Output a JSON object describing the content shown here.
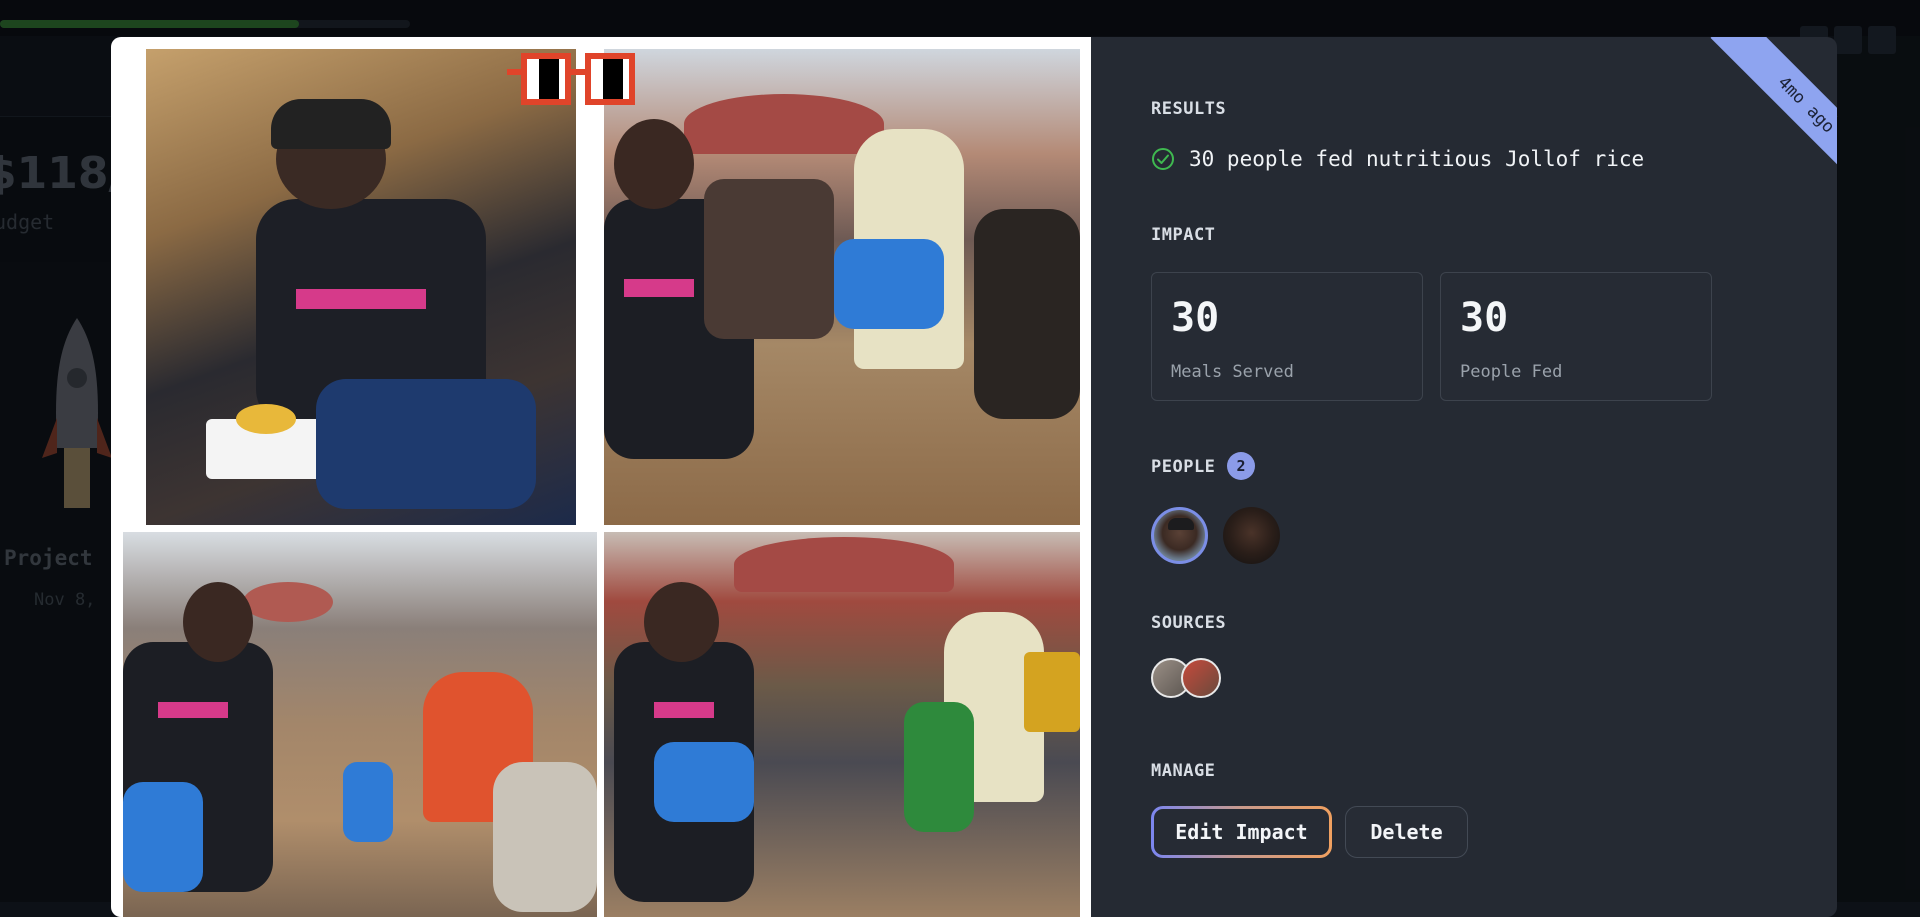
{
  "background_page": {
    "budget_amount": "$118/",
    "budget_label": "udget",
    "project_title": "Project ",
    "project_date": "Nov 8,",
    "progress_fraction": 0.73
  },
  "modal": {
    "ribbon_text": "4mo ago",
    "results": {
      "label": "RESULTS",
      "items": [
        "30 people fed nutritious Jollof rice"
      ]
    },
    "impact": {
      "label": "IMPACT",
      "cards": [
        {
          "value": "30",
          "label": "Meals Served"
        },
        {
          "value": "30",
          "label": "People Fed"
        }
      ]
    },
    "people": {
      "label": "PEOPLE",
      "count": "2"
    },
    "sources": {
      "label": "SOURCES"
    },
    "manage": {
      "label": "MANAGE",
      "edit_label": "Edit Impact",
      "delete_label": "Delete"
    }
  },
  "colors": {
    "accent": "#8ea4f0",
    "success": "#3fb950",
    "panel": "#252a33"
  }
}
